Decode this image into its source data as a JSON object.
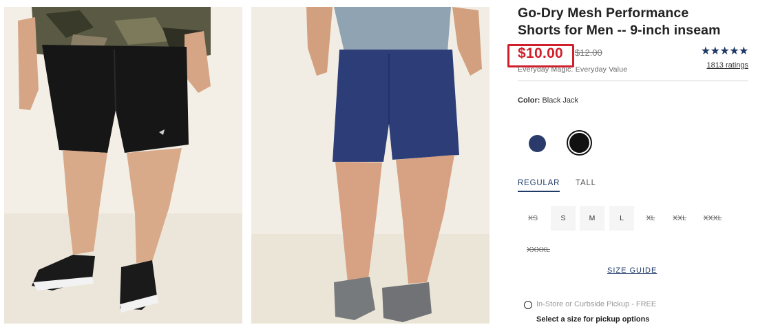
{
  "product": {
    "title_line1": "Go-Dry Mesh Performance",
    "title_line2": "Shorts for Men -- 9-inch inseam",
    "price_current": "$10.00",
    "price_original": "$12.00",
    "price_tagline": "Everyday Magic. Everyday Value",
    "rating_stars": "★★★★★",
    "rating_value": 5,
    "ratings_count_label": "1813 ratings"
  },
  "color": {
    "label": "Color:",
    "selected_name": "Black Jack",
    "swatches": [
      {
        "name": "navy",
        "hex": "#2a3b6b",
        "selected": false
      },
      {
        "name": "black",
        "hex": "#111111",
        "selected": true
      }
    ]
  },
  "fit": {
    "tabs": [
      "REGULAR",
      "TALL"
    ],
    "selected": "REGULAR"
  },
  "sizes": [
    {
      "label": "XS",
      "available": false
    },
    {
      "label": "S",
      "available": true
    },
    {
      "label": "M",
      "available": true
    },
    {
      "label": "L",
      "available": true
    },
    {
      "label": "XL",
      "available": false
    },
    {
      "label": "XXL",
      "available": false
    },
    {
      "label": "XXXL",
      "available": false
    },
    {
      "label": "XXXXL",
      "available": false
    }
  ],
  "size_guide_label": "SIZE GUIDE",
  "pickup": {
    "option_label": "In-Store or Curbside Pickup - FREE",
    "note": "Select a size for pickup options"
  },
  "colors": {
    "brand_navy": "#1f3a67",
    "sale_red": "#d01f2a",
    "photo_background": "#f3efe6"
  }
}
